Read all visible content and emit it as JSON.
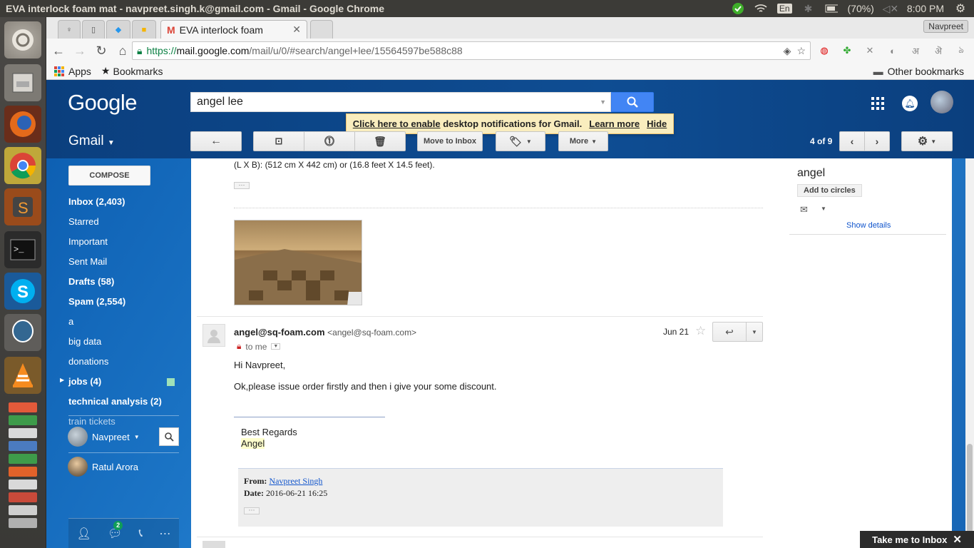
{
  "os": {
    "window_title": "EVA interlock foam mat - navpreet.singh.k@gmail.com - Gmail - Google Chrome",
    "keyboard": "En",
    "battery": "(70%)",
    "time": "8:00 PM"
  },
  "browser": {
    "active_tab_title": "EVA interlock foam",
    "profile_name": "Navpreet",
    "url_protocol": "https://",
    "url_host": "mail.google.com",
    "url_path": "/mail/u/0/#search/angel+lee/15564597be588c88",
    "bookmarks": {
      "apps": "Apps",
      "bookmarks": "Bookmarks",
      "other": "Other bookmarks"
    }
  },
  "gmail": {
    "logo": "Google",
    "search_query": "angel lee",
    "notification": {
      "prefix": "Click here to enable",
      "text": "desktop notifications for Gmail.",
      "learn_more": "Learn more",
      "hide": "Hide"
    },
    "app_label": "Gmail",
    "toolbar": {
      "move_to_inbox": "Move to Inbox",
      "more": "More",
      "pager": "4 of 9"
    },
    "compose": "COMPOSE",
    "nav": [
      {
        "label": "Inbox (2,403)",
        "bold": true
      },
      {
        "label": "Starred",
        "bold": false
      },
      {
        "label": "Important",
        "bold": false
      },
      {
        "label": "Sent Mail",
        "bold": false
      },
      {
        "label": "Drafts (58)",
        "bold": true
      },
      {
        "label": "Spam (2,554)",
        "bold": true
      },
      {
        "label": "a",
        "bold": false
      },
      {
        "label": "big data",
        "bold": false
      },
      {
        "label": "donations",
        "bold": false
      },
      {
        "label": "jobs (4)",
        "bold": true
      },
      {
        "label": "technical analysis (2)",
        "bold": true
      },
      {
        "label": "train tickets",
        "bold": false
      }
    ],
    "hangouts": {
      "me": "Navpreet",
      "contact": "Ratul Arora",
      "badge": "2"
    },
    "thread": {
      "prev_text": "(L X B): (512 cm X 442 cm) or (16.8 feet X 14.5 feet).",
      "sender_name": "angel@sq-foam.com",
      "sender_email": "<angel@sq-foam.com>",
      "to": "to me",
      "date": "Jun 21",
      "greeting": "Hi Navpreet,",
      "body": "Ok,please issue order firstly and then i give your some discount.",
      "sig_regards": "Best Regards",
      "sig_name": "Angel",
      "quote_from_label": "From:",
      "quote_from": "Navpreet Singh",
      "quote_date_label": "Date:",
      "quote_date": "2016-06-21 16:25"
    },
    "contact_card": {
      "name": "angel",
      "add": "Add to circles",
      "details": "Show details"
    },
    "take_me": "Take me to Inbox"
  }
}
